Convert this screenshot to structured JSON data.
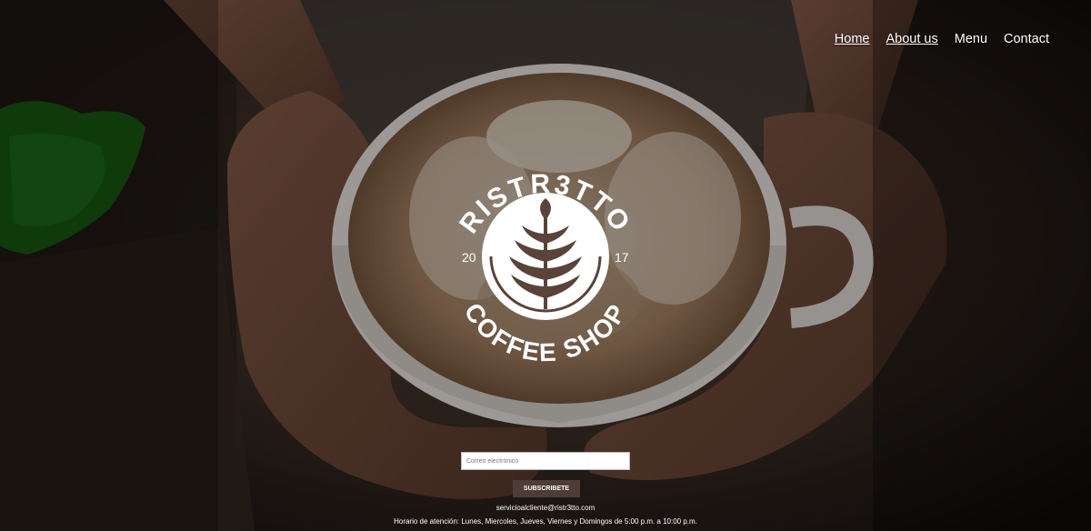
{
  "nav": {
    "items": [
      {
        "label": "Home"
      },
      {
        "label": "About us"
      },
      {
        "label": "Menu"
      },
      {
        "label": "Contact"
      }
    ]
  },
  "logo": {
    "top_text": "RISTR3TTO",
    "year_left": "20",
    "year_right": "17",
    "bottom_text": "COFFEE SHOP"
  },
  "subscribe": {
    "placeholder": "Correo electrónico",
    "button_label": "SUBSCRIBETE"
  },
  "footer": {
    "email": "servicioalcliente@ristr3tto.com",
    "hours": "Horario de atención: Lunes, Miercoles, Jueves, Viernes y Domingos de 5:00 p.m. a 10:00 p.m."
  },
  "colors": {
    "button_bg": "#4d3d36",
    "text": "#ffffff",
    "background": "#1a1612"
  }
}
